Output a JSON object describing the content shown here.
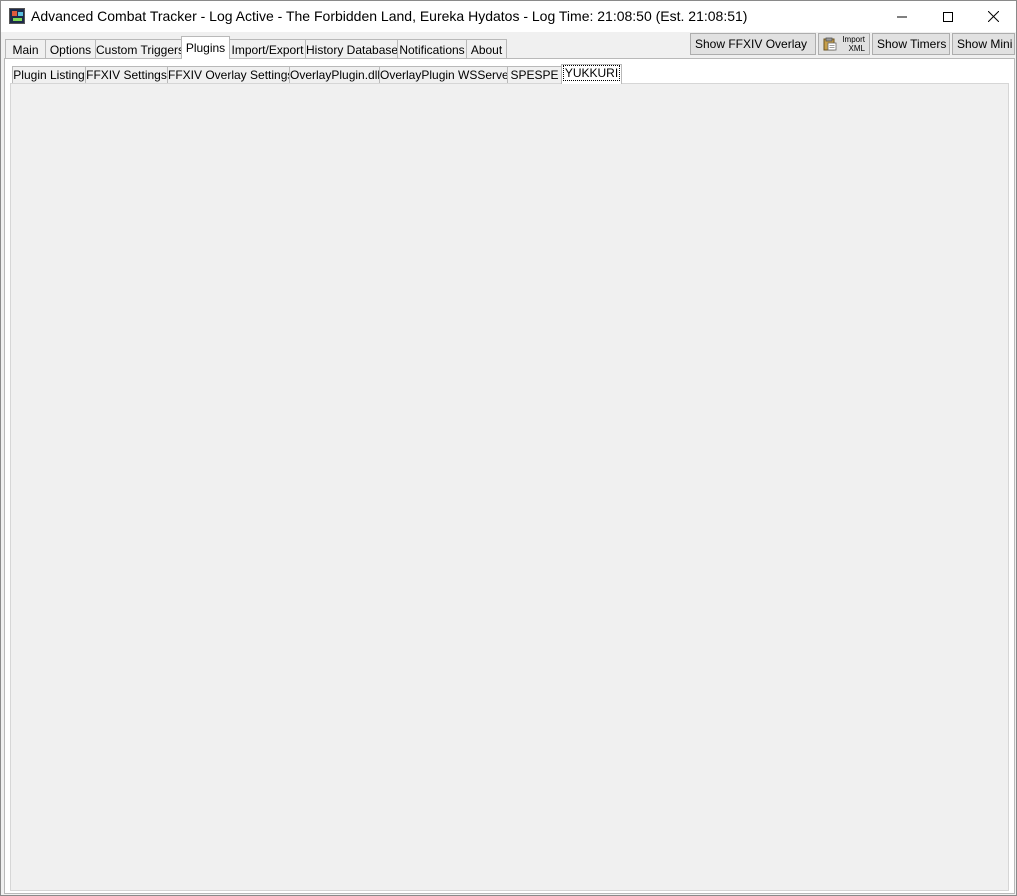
{
  "window": {
    "title": "Advanced Combat Tracker - Log Active - The Forbidden Land, Eureka Hydatos - Log Time: 21:08:50 (Est. 21:08:51)",
    "controls": {
      "minimize": "minimize-icon",
      "maximize": "maximize-icon",
      "close": "close-icon"
    }
  },
  "main_tabs": [
    {
      "label": "Main"
    },
    {
      "label": "Options"
    },
    {
      "label": "Custom Triggers"
    },
    {
      "label": "Plugins",
      "active": true
    },
    {
      "label": "Import/Export"
    },
    {
      "label": "History Database"
    },
    {
      "label": "Notifications"
    },
    {
      "label": "About"
    }
  ],
  "toolbar": {
    "show_overlay": "Show FFXIV Overlay",
    "import_xml_line1": "Import",
    "import_xml_line2": "XML",
    "show_timers": "Show Timers",
    "show_mini": "Show Mini"
  },
  "sub_tabs": [
    {
      "label": "Plugin Listing"
    },
    {
      "label": "FFXIV Settings"
    },
    {
      "label": "FFXIV Overlay Settings"
    },
    {
      "label": "OverlayPlugin.dll"
    },
    {
      "label": "OverlayPlugin WSServer"
    },
    {
      "label": "SPESPE"
    },
    {
      "label": "YUKKURI",
      "active": true
    }
  ]
}
